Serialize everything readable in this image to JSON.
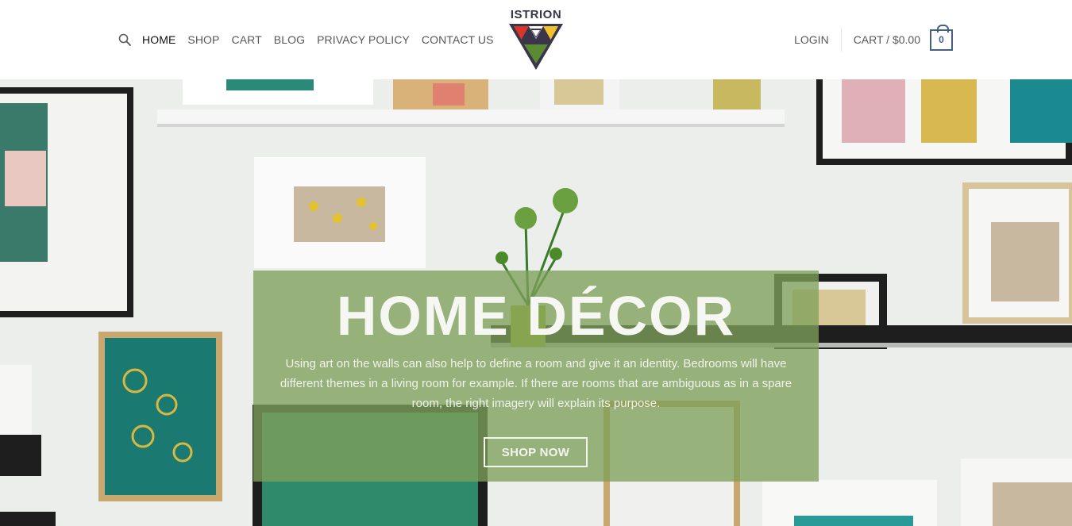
{
  "header": {
    "nav": [
      "HOME",
      "SHOP",
      "CART",
      "BLOG",
      "PRIVACY POLICY",
      "CONTACT US"
    ],
    "logo_text": "ISTRION",
    "login_label": "LOGIN",
    "cart_label": "CART / $0.00",
    "cart_count": "0"
  },
  "hero": {
    "title": "HOME DÉCOR",
    "text": "Using art on the walls can also help to define a room and give it an identity. Bedrooms will have different themes in a living room for example. If there are rooms that are ambiguous as in a spare room, the right imagery will explain its purpose.",
    "button_label": "SHOP NOW"
  },
  "colors": {
    "accent": "#446084",
    "logo_red": "#d8362b",
    "logo_yellow": "#f2c12e",
    "logo_green": "#5a8a32",
    "logo_dark": "#3a3548"
  },
  "icons": {
    "search": "search-icon",
    "logo": "triangle-logo"
  }
}
